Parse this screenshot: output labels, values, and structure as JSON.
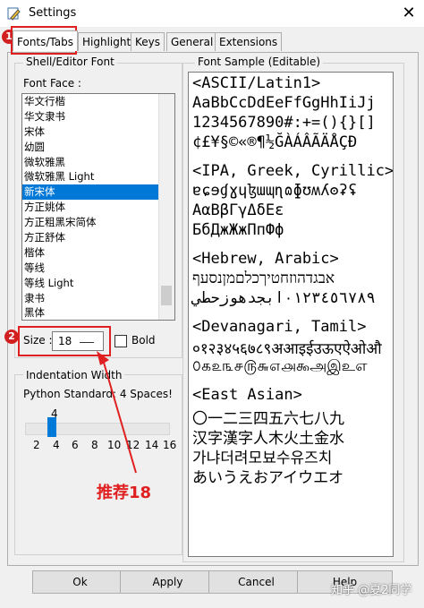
{
  "window": {
    "title": "Settings",
    "close_glyph": "✕"
  },
  "tabs": [
    "Fonts/Tabs",
    "Highlights",
    "Keys",
    "General",
    "Extensions"
  ],
  "font_group": {
    "label": "Shell/Editor Font",
    "font_face_label": "Font Face :",
    "fonts": [
      "华文行楷",
      "华文隶书",
      "宋体",
      "幼圆",
      "微软雅黑",
      "微软雅黑 Light",
      "新宋体",
      "方正姚体",
      "方正粗黑宋简体",
      "方正舒体",
      "楷体",
      "等线",
      "等线 Light",
      "隶书",
      "黑体"
    ],
    "selected_font": "新宋体",
    "size_label": "Size :",
    "size_value": "18",
    "bold_label": "Bold"
  },
  "indent_group": {
    "label": "Indentation Width",
    "python_standard": "Python Standard: 4 Spaces!",
    "slider_value": "4",
    "ticks": [
      "2",
      "4",
      "6",
      "8",
      "10",
      "12",
      "14",
      "16"
    ]
  },
  "sample": {
    "label": "Font Sample (Editable)",
    "lines": [
      "<ASCII/Latin1>",
      "AaBbCcDdEeFfGgHhIiJj",
      "1234567890#:+=(){}[]",
      "¢£¥§©«®¶½ĞÀÁÂÃÄÅÇÐ",
      "",
      "<IPA, Greek, Cyrillic>",
      "ɐɕɘɠɣɥɮɯɰɳɷɸʊʍʎʘʡʢ",
      "ΑαΒβΓγΔδΕε",
      "БбДжЖжПпФф",
      "",
      "<Hebrew, Arabic>",
      "אבגדהוזחטיךכלםמןנסעף",
      "٠١٢٣٤٥٦٧٨٩ابجدهوزحطي",
      "",
      "<Devanagari, Tamil>",
      "०१२३४५६७८९अआइईउऊएऐओऔ",
      "௦௧௨௩௪௫௬௭௮௯அஇஉஎ",
      "",
      "<East Asian>",
      "〇一二三四五六七八九",
      "汉字漢字人木火土金水",
      "가냐더려모뵤수유즈치",
      "あいうえおアイウエオ"
    ]
  },
  "buttons": {
    "ok": "Ok",
    "apply": "Apply",
    "cancel": "Cancel",
    "help": "Help"
  },
  "annotations": {
    "badge1": "1",
    "badge2": "2",
    "note": "推荐18"
  },
  "watermark": "知乎 @夏2同学",
  "colors": {
    "accent": "#0078d7",
    "annotation_red": "#e02020"
  }
}
